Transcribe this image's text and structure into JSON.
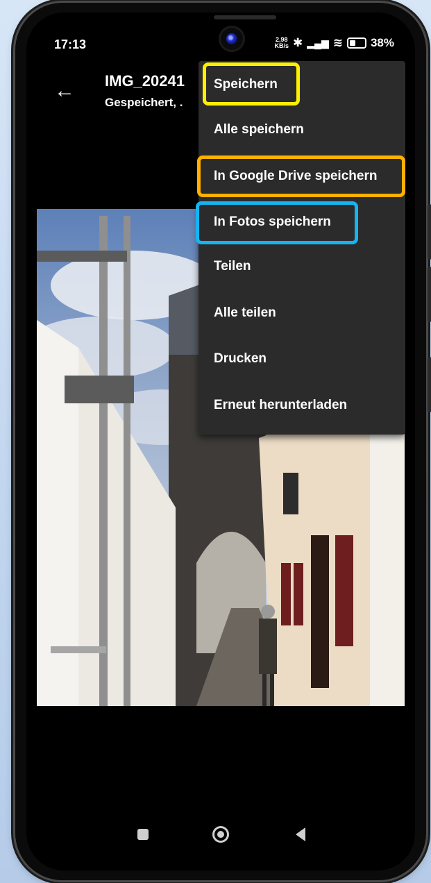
{
  "status_bar": {
    "time": "17:13",
    "net_speed_top": "2,98",
    "net_speed_bottom": "KB/s",
    "bluetooth_icon": "bluetooth-icon",
    "signal_icon": "signal-icon",
    "wifi_icon": "wifi-icon",
    "battery": "38%"
  },
  "header": {
    "back_icon": "arrow-left-icon",
    "title": "IMG_20241",
    "subtitle": "Gespeichert, ."
  },
  "menu": {
    "items": [
      {
        "label": "Speichern"
      },
      {
        "label": "Alle speichern"
      },
      {
        "label": "In Google Drive speichern"
      },
      {
        "label": "In Fotos speichern"
      },
      {
        "label": "Teilen"
      },
      {
        "label": "Alle teilen"
      },
      {
        "label": "Drucken"
      },
      {
        "label": "Erneut herunterladen"
      }
    ]
  },
  "highlight_colors": {
    "speichern": "#ffef00",
    "google_drive": "#ffb000",
    "fotos": "#16b4f0"
  },
  "navbar": {
    "recents_icon": "square-icon",
    "home_icon": "circle-icon",
    "back_icon": "triangle-back-icon"
  }
}
